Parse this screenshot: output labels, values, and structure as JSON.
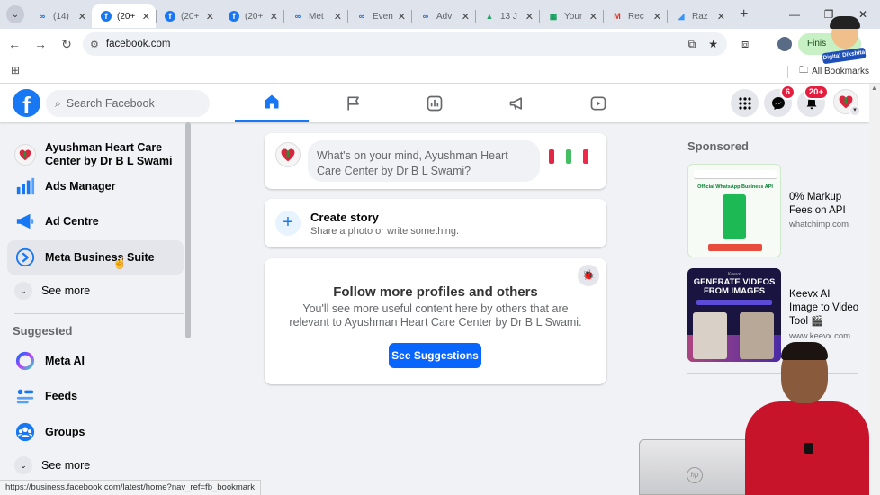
{
  "browser": {
    "tabs": [
      {
        "title": "(14)",
        "icon": "meta-icon",
        "active": false
      },
      {
        "title": "(20+",
        "icon": "facebook-icon",
        "active": true
      },
      {
        "title": "(20+",
        "icon": "facebook-icon",
        "active": false
      },
      {
        "title": "(20+",
        "icon": "facebook-icon",
        "active": false
      },
      {
        "title": "Met",
        "icon": "meta-icon",
        "active": false
      },
      {
        "title": "Even",
        "icon": "meta-icon",
        "active": false
      },
      {
        "title": "Adv",
        "icon": "meta-icon",
        "active": false
      },
      {
        "title": "13 J",
        "icon": "google-drive-icon",
        "active": false
      },
      {
        "title": "Your",
        "icon": "google-sheets-icon",
        "active": false
      },
      {
        "title": "Rec",
        "icon": "gmail-icon",
        "active": false
      },
      {
        "title": "Raz",
        "icon": "razorpay-icon",
        "active": false
      }
    ],
    "url": "facebook.com",
    "finish_chip": "Finis",
    "all_bookmarks": "All Bookmarks",
    "status_url": "https://business.facebook.com/latest/home?nav_ref=fb_bookmark"
  },
  "header": {
    "search_placeholder": "Search Facebook",
    "messenger_badge": "6",
    "notifications_badge": "20+"
  },
  "left_nav": {
    "profile_name": "Ayushman Heart Care Center by Dr B L Swami",
    "items": [
      {
        "label": "Ads Manager",
        "icon": "ads-manager-icon"
      },
      {
        "label": "Ad Centre",
        "icon": "ad-centre-icon"
      },
      {
        "label": "Meta Business Suite",
        "icon": "meta-business-suite-icon"
      }
    ],
    "see_more_1": "See more",
    "suggested_heading": "Suggested",
    "suggested": [
      {
        "label": "Meta AI",
        "icon": "meta-ai-icon"
      },
      {
        "label": "Feeds",
        "icon": "feeds-icon"
      },
      {
        "label": "Groups",
        "icon": "groups-icon"
      }
    ],
    "see_more_2": "See more"
  },
  "feed": {
    "composer_placeholder": "What's on your mind, Ayushman Heart Care Center by Dr B L Swami?",
    "story_title": "Create story",
    "story_subtitle": "Share a photo or write something.",
    "follow_heading": "Follow more profiles and others",
    "follow_text": "You'll see more useful content here by others that are relevant to Ayushman Heart Care Center by Dr B L Swami.",
    "suggestions_button": "See Suggestions"
  },
  "sponsored": {
    "heading": "Sponsored",
    "ads": [
      {
        "title": "0% Markup Fees on API",
        "domain": "whatchimp.com",
        "image_headline": "Official WhatsApp Business API"
      },
      {
        "title": "Keevx AI Image to Video Tool 🎬",
        "domain": "www.keevx.com",
        "image_brand": "Keevx",
        "image_headline": "GENERATE VIDEOS FROM IMAGES"
      }
    ]
  },
  "overlay": {
    "mascot_badge": "Digital Dikshita"
  },
  "colors": {
    "facebook_blue": "#1877f2",
    "button_blue": "#0866ff",
    "badge_red": "#e41e3f",
    "page_bg": "#f0f2f5"
  }
}
